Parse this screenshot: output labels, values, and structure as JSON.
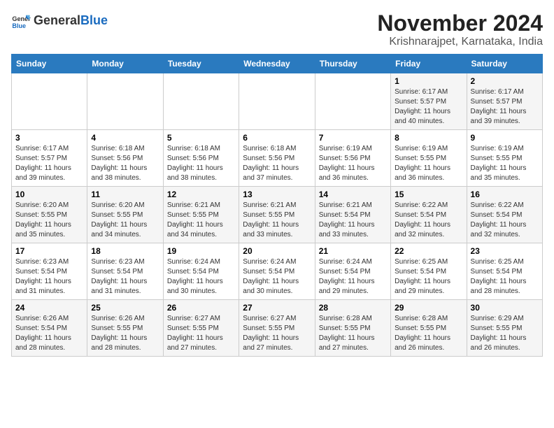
{
  "header": {
    "logo_general": "General",
    "logo_blue": "Blue",
    "month_title": "November 2024",
    "location": "Krishnarajpet, Karnataka, India"
  },
  "weekdays": [
    "Sunday",
    "Monday",
    "Tuesday",
    "Wednesday",
    "Thursday",
    "Friday",
    "Saturday"
  ],
  "weeks": [
    [
      {
        "day": "",
        "info": ""
      },
      {
        "day": "",
        "info": ""
      },
      {
        "day": "",
        "info": ""
      },
      {
        "day": "",
        "info": ""
      },
      {
        "day": "",
        "info": ""
      },
      {
        "day": "1",
        "info": "Sunrise: 6:17 AM\nSunset: 5:57 PM\nDaylight: 11 hours\nand 40 minutes."
      },
      {
        "day": "2",
        "info": "Sunrise: 6:17 AM\nSunset: 5:57 PM\nDaylight: 11 hours\nand 39 minutes."
      }
    ],
    [
      {
        "day": "3",
        "info": "Sunrise: 6:17 AM\nSunset: 5:57 PM\nDaylight: 11 hours\nand 39 minutes."
      },
      {
        "day": "4",
        "info": "Sunrise: 6:18 AM\nSunset: 5:56 PM\nDaylight: 11 hours\nand 38 minutes."
      },
      {
        "day": "5",
        "info": "Sunrise: 6:18 AM\nSunset: 5:56 PM\nDaylight: 11 hours\nand 38 minutes."
      },
      {
        "day": "6",
        "info": "Sunrise: 6:18 AM\nSunset: 5:56 PM\nDaylight: 11 hours\nand 37 minutes."
      },
      {
        "day": "7",
        "info": "Sunrise: 6:19 AM\nSunset: 5:56 PM\nDaylight: 11 hours\nand 36 minutes."
      },
      {
        "day": "8",
        "info": "Sunrise: 6:19 AM\nSunset: 5:55 PM\nDaylight: 11 hours\nand 36 minutes."
      },
      {
        "day": "9",
        "info": "Sunrise: 6:19 AM\nSunset: 5:55 PM\nDaylight: 11 hours\nand 35 minutes."
      }
    ],
    [
      {
        "day": "10",
        "info": "Sunrise: 6:20 AM\nSunset: 5:55 PM\nDaylight: 11 hours\nand 35 minutes."
      },
      {
        "day": "11",
        "info": "Sunrise: 6:20 AM\nSunset: 5:55 PM\nDaylight: 11 hours\nand 34 minutes."
      },
      {
        "day": "12",
        "info": "Sunrise: 6:21 AM\nSunset: 5:55 PM\nDaylight: 11 hours\nand 34 minutes."
      },
      {
        "day": "13",
        "info": "Sunrise: 6:21 AM\nSunset: 5:55 PM\nDaylight: 11 hours\nand 33 minutes."
      },
      {
        "day": "14",
        "info": "Sunrise: 6:21 AM\nSunset: 5:54 PM\nDaylight: 11 hours\nand 33 minutes."
      },
      {
        "day": "15",
        "info": "Sunrise: 6:22 AM\nSunset: 5:54 PM\nDaylight: 11 hours\nand 32 minutes."
      },
      {
        "day": "16",
        "info": "Sunrise: 6:22 AM\nSunset: 5:54 PM\nDaylight: 11 hours\nand 32 minutes."
      }
    ],
    [
      {
        "day": "17",
        "info": "Sunrise: 6:23 AM\nSunset: 5:54 PM\nDaylight: 11 hours\nand 31 minutes."
      },
      {
        "day": "18",
        "info": "Sunrise: 6:23 AM\nSunset: 5:54 PM\nDaylight: 11 hours\nand 31 minutes."
      },
      {
        "day": "19",
        "info": "Sunrise: 6:24 AM\nSunset: 5:54 PM\nDaylight: 11 hours\nand 30 minutes."
      },
      {
        "day": "20",
        "info": "Sunrise: 6:24 AM\nSunset: 5:54 PM\nDaylight: 11 hours\nand 30 minutes."
      },
      {
        "day": "21",
        "info": "Sunrise: 6:24 AM\nSunset: 5:54 PM\nDaylight: 11 hours\nand 29 minutes."
      },
      {
        "day": "22",
        "info": "Sunrise: 6:25 AM\nSunset: 5:54 PM\nDaylight: 11 hours\nand 29 minutes."
      },
      {
        "day": "23",
        "info": "Sunrise: 6:25 AM\nSunset: 5:54 PM\nDaylight: 11 hours\nand 28 minutes."
      }
    ],
    [
      {
        "day": "24",
        "info": "Sunrise: 6:26 AM\nSunset: 5:54 PM\nDaylight: 11 hours\nand 28 minutes."
      },
      {
        "day": "25",
        "info": "Sunrise: 6:26 AM\nSunset: 5:55 PM\nDaylight: 11 hours\nand 28 minutes."
      },
      {
        "day": "26",
        "info": "Sunrise: 6:27 AM\nSunset: 5:55 PM\nDaylight: 11 hours\nand 27 minutes."
      },
      {
        "day": "27",
        "info": "Sunrise: 6:27 AM\nSunset: 5:55 PM\nDaylight: 11 hours\nand 27 minutes."
      },
      {
        "day": "28",
        "info": "Sunrise: 6:28 AM\nSunset: 5:55 PM\nDaylight: 11 hours\nand 27 minutes."
      },
      {
        "day": "29",
        "info": "Sunrise: 6:28 AM\nSunset: 5:55 PM\nDaylight: 11 hours\nand 26 minutes."
      },
      {
        "day": "30",
        "info": "Sunrise: 6:29 AM\nSunset: 5:55 PM\nDaylight: 11 hours\nand 26 minutes."
      }
    ]
  ]
}
